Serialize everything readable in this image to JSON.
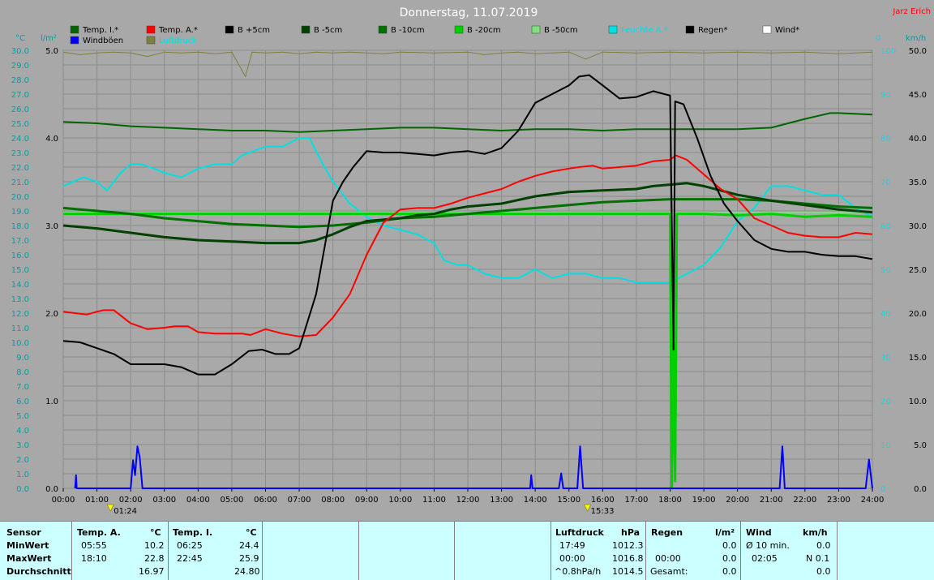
{
  "header": {
    "title": "Donnerstag, 11.07.2019",
    "station": "Jarz Erich"
  },
  "units": {
    "temp": "°C",
    "rain": "l/m²",
    "wind_left": "0",
    "wind": "km/h"
  },
  "legend": [
    {
      "label": "Temp. I.*",
      "color": "#006400"
    },
    {
      "label": "Temp. A.*",
      "color": "#ff0000"
    },
    {
      "label": "B +5cm",
      "color": "#000000"
    },
    {
      "label": "B -5cm",
      "color": "#004000"
    },
    {
      "label": "B -10cm",
      "color": "#007000"
    },
    {
      "label": "B -20cm",
      "color": "#00d000"
    },
    {
      "label": "B -50cm",
      "color": "#80e080"
    },
    {
      "label": "Feuchte A.*",
      "color": "#00e0e0"
    },
    {
      "label": "Regen*",
      "color": "#000000"
    },
    {
      "label": "Wind*",
      "color": "#ffffff"
    },
    {
      "label": "Windböen",
      "color": "#0000ff"
    },
    {
      "label": "Luftdruck",
      "color": "#7f7f3f"
    }
  ],
  "chart_data": {
    "type": "line",
    "title": "Donnerstag, 11.07.2019",
    "x_ticks": [
      "00:00",
      "01:00",
      "02:00",
      "03:00",
      "04:00",
      "05:00",
      "06:00",
      "07:00",
      "08:00",
      "09:00",
      "10:00",
      "11:00",
      "12:00",
      "13:00",
      "14:00",
      "15:00",
      "16:00",
      "17:00",
      "18:00",
      "19:00",
      "20:00",
      "21:00",
      "22:00",
      "23:00",
      "24:00"
    ],
    "xlim": [
      0,
      24
    ],
    "left_axis": {
      "unit": "°C",
      "ylim": [
        0,
        30
      ],
      "ticks": [
        "0.0",
        "1.0",
        "2.0",
        "3.0",
        "4.0",
        "5.0",
        "6.0",
        "7.0",
        "8.0",
        "9.0",
        "10.0",
        "11.0",
        "12.0",
        "13.0",
        "14.0",
        "15.0",
        "16.0",
        "17.0",
        "18.0",
        "19.0",
        "20.0",
        "21.0",
        "22.0",
        "23.0",
        "24.0",
        "25.0",
        "26.0",
        "27.0",
        "28.0",
        "29.0",
        "30.0"
      ]
    },
    "rain_axis": {
      "unit": "l/m²",
      "ylim": [
        0,
        5
      ],
      "ticks": [
        "0.0",
        "1.0",
        "2.0",
        "3.0",
        "4.0",
        "5.0"
      ]
    },
    "humidity_axis": {
      "ylim": [
        0,
        100
      ],
      "ticks": [
        "0",
        "10",
        "20",
        "30",
        "40",
        "50",
        "60",
        "70",
        "80",
        "90",
        "100"
      ]
    },
    "wind_axis": {
      "unit": "km/h",
      "ylim": [
        0,
        50
      ],
      "ticks": [
        "0.0",
        "5.0",
        "10.0",
        "15.0",
        "20.0",
        "25.0",
        "30.0",
        "35.0",
        "40.0",
        "45.0",
        "50.0"
      ]
    },
    "event_markers": [
      {
        "x": 1.4,
        "label": "01:24"
      },
      {
        "x": 15.55,
        "label": "15:33"
      }
    ],
    "series": [
      {
        "name": "Temp. I.*",
        "axis": "temp",
        "color": "#006400",
        "x": [
          0,
          1,
          2,
          3,
          4,
          5,
          6,
          7,
          8,
          9,
          10,
          11,
          12,
          13,
          14,
          15,
          16,
          17,
          18,
          19,
          20,
          21,
          22,
          22.75,
          23,
          24
        ],
        "y": [
          25.1,
          25.0,
          24.8,
          24.7,
          24.6,
          24.5,
          24.5,
          24.4,
          24.5,
          24.6,
          24.7,
          24.7,
          24.6,
          24.5,
          24.6,
          24.6,
          24.5,
          24.6,
          24.6,
          24.6,
          24.6,
          24.7,
          25.3,
          25.7,
          25.7,
          25.6
        ]
      },
      {
        "name": "Temp. A.*",
        "axis": "temp",
        "color": "#ff0000",
        "x": [
          0,
          0.7,
          1,
          1.2,
          1.5,
          2,
          2.5,
          3,
          3.3,
          3.7,
          4,
          4.5,
          5,
          5.3,
          5.55,
          6,
          6.5,
          7,
          7.5,
          8,
          8.5,
          9,
          9.5,
          10,
          10.5,
          11,
          11.5,
          12,
          12.5,
          13,
          13.5,
          14,
          14.5,
          15,
          15.3,
          15.7,
          16,
          16.5,
          17,
          17.5,
          18,
          18.17,
          18.5,
          19,
          19.5,
          20,
          20.5,
          21,
          21.5,
          22,
          22.5,
          23,
          23.5,
          24
        ],
        "y": [
          12.1,
          11.9,
          12.1,
          12.2,
          12.2,
          11.3,
          10.9,
          11.0,
          11.1,
          11.1,
          10.7,
          10.6,
          10.6,
          10.6,
          10.5,
          10.9,
          10.6,
          10.4,
          10.5,
          11.7,
          13.3,
          16.0,
          18.2,
          19.1,
          19.2,
          19.2,
          19.5,
          19.9,
          20.2,
          20.5,
          21.0,
          21.4,
          21.7,
          21.9,
          22.0,
          22.1,
          21.9,
          22.0,
          22.1,
          22.4,
          22.5,
          22.8,
          22.5,
          21.5,
          20.5,
          19.8,
          18.5,
          18.0,
          17.5,
          17.3,
          17.2,
          17.2,
          17.5,
          17.4
        ]
      },
      {
        "name": "B +5cm",
        "axis": "temp",
        "color": "#000000",
        "x": [
          0,
          0.5,
          1,
          1.5,
          2,
          2.5,
          3,
          3.5,
          4,
          4.5,
          5,
          5.5,
          5.9,
          6.3,
          6.7,
          7,
          7.5,
          8,
          8.3,
          8.6,
          9,
          9.5,
          10,
          10.5,
          11,
          11.5,
          12,
          12.5,
          13,
          13.5,
          14,
          14.5,
          15,
          15.3,
          15.6,
          16,
          16.5,
          17,
          17.5,
          18,
          18.1,
          18.15,
          18.4,
          18.8,
          19.2,
          19.6,
          20,
          20.5,
          21,
          21.5,
          22,
          22.5,
          23,
          23.5,
          24
        ],
        "y": [
          10.1,
          10.0,
          9.6,
          9.2,
          8.5,
          8.5,
          8.5,
          8.3,
          7.8,
          7.8,
          8.5,
          9.4,
          9.5,
          9.2,
          9.2,
          9.6,
          13.3,
          19.7,
          21.0,
          22.0,
          23.1,
          23.0,
          23.0,
          22.9,
          22.8,
          23.0,
          23.1,
          22.9,
          23.3,
          24.5,
          26.4,
          27.0,
          27.6,
          28.2,
          28.3,
          27.6,
          26.7,
          26.8,
          27.2,
          26.9,
          9.5,
          26.5,
          26.3,
          24.0,
          21.4,
          19.5,
          18.3,
          17.0,
          16.4,
          16.2,
          16.2,
          16.0,
          15.9,
          15.9,
          15.7
        ]
      },
      {
        "name": "B -5cm",
        "axis": "temp",
        "color": "#004000",
        "x": [
          0,
          1,
          2,
          3,
          4,
          5,
          6,
          6.5,
          7,
          7.5,
          8,
          8.5,
          9,
          9.5,
          10,
          10.5,
          11,
          11.5,
          12,
          13,
          14,
          15,
          16,
          17,
          17.5,
          18,
          18.5,
          19,
          19.5,
          20,
          21,
          22,
          23,
          24
        ],
        "y": [
          18.0,
          17.8,
          17.5,
          17.2,
          17.0,
          16.9,
          16.8,
          16.8,
          16.8,
          17.0,
          17.4,
          17.9,
          18.3,
          18.4,
          18.5,
          18.7,
          18.8,
          19.1,
          19.3,
          19.5,
          20.0,
          20.3,
          20.4,
          20.5,
          20.7,
          20.8,
          20.9,
          20.7,
          20.4,
          20.1,
          19.7,
          19.4,
          19.1,
          18.9
        ]
      },
      {
        "name": "B -10cm",
        "axis": "temp",
        "color": "#007000",
        "x": [
          0,
          1,
          2,
          3,
          4,
          5,
          6,
          7,
          8,
          9,
          10,
          11,
          12,
          13,
          14,
          15,
          16,
          17,
          18,
          19,
          20,
          21,
          22,
          23,
          24
        ],
        "y": [
          19.2,
          19.0,
          18.8,
          18.5,
          18.3,
          18.1,
          18.0,
          17.9,
          18.0,
          18.2,
          18.5,
          18.6,
          18.8,
          19.0,
          19.2,
          19.4,
          19.6,
          19.7,
          19.8,
          19.8,
          19.8,
          19.7,
          19.5,
          19.3,
          19.2
        ]
      },
      {
        "name": "B -20cm",
        "axis": "temp",
        "color": "#00d000",
        "x": [
          0,
          3,
          6,
          9,
          12,
          15,
          17,
          18,
          18.05,
          18.1,
          18.15,
          18.2,
          19,
          20,
          21,
          22,
          23,
          24
        ],
        "y": [
          18.8,
          18.8,
          18.8,
          18.8,
          18.8,
          18.8,
          18.8,
          18.8,
          0.0,
          10.0,
          0.5,
          18.8,
          18.8,
          18.7,
          18.8,
          18.6,
          18.7,
          18.6
        ]
      },
      {
        "name": "B -50cm",
        "axis": "temp",
        "color": "#80e080",
        "x": [
          0,
          24
        ],
        "y": [
          18.9,
          18.9
        ]
      },
      {
        "name": "Feuchte A.*",
        "axis": "humidity",
        "color": "#00e0e0",
        "x": [
          0,
          0.6,
          1,
          1.3,
          1.7,
          2,
          2.3,
          2.7,
          3,
          3.5,
          4,
          4.5,
          5,
          5.3,
          6,
          6.5,
          7,
          7.3,
          7.7,
          8,
          8.5,
          9,
          9.5,
          10,
          10.5,
          11,
          11.3,
          11.7,
          12,
          12.5,
          13,
          13.5,
          14,
          14.5,
          15,
          15.5,
          16,
          16.5,
          17,
          17.5,
          18,
          18.5,
          19,
          19.5,
          20,
          20.5,
          21,
          21.5,
          22,
          22.5,
          23,
          23.5,
          24
        ],
        "y": [
          69,
          71,
          70,
          68,
          72,
          74,
          74,
          73,
          72,
          71,
          73,
          74,
          74,
          76,
          78,
          78,
          80,
          80,
          74,
          70,
          65,
          62,
          60,
          59,
          58,
          56,
          52,
          51,
          51,
          49,
          48,
          48,
          50,
          48,
          49,
          49,
          48,
          48,
          47,
          47,
          47,
          49,
          51,
          55,
          61,
          64,
          69,
          69,
          68,
          67,
          67,
          64,
          62
        ]
      },
      {
        "name": "Luftdruck",
        "axis": "top",
        "color": "#7f7f3f",
        "x": [
          0,
          0.5,
          1,
          1.5,
          2,
          2.5,
          3,
          3.5,
          4,
          4.5,
          5,
          5.4,
          5.6,
          6,
          6.5,
          7,
          7.5,
          8,
          8.5,
          9,
          9.5,
          10,
          11,
          12,
          12.5,
          13,
          13.5,
          14,
          14.5,
          15,
          15.5,
          16,
          17,
          18,
          19,
          20,
          21,
          22,
          23,
          24
        ],
        "y": [
          4.98,
          4.95,
          4.97,
          4.98,
          4.97,
          4.93,
          4.98,
          4.97,
          4.98,
          4.96,
          4.98,
          4.7,
          4.98,
          4.97,
          4.98,
          4.96,
          4.98,
          4.97,
          4.98,
          4.97,
          4.96,
          4.98,
          4.97,
          4.98,
          4.95,
          4.97,
          4.98,
          4.96,
          4.97,
          4.98,
          4.9,
          4.98,
          4.97,
          4.98,
          4.97,
          4.98,
          4.97,
          4.98,
          4.96,
          4.98
        ]
      },
      {
        "name": "Windböen",
        "axis": "wind",
        "color": "#0000ff",
        "x": [
          0.35,
          0.38,
          0.4,
          2.0,
          2.07,
          2.13,
          2.2,
          2.27,
          2.35,
          2.45,
          13.85,
          13.88,
          13.92,
          14.7,
          14.77,
          14.83,
          15.25,
          15.33,
          15.42,
          21.25,
          21.33,
          21.4,
          23.8,
          23.9,
          24.0
        ],
        "y": [
          0,
          1.5,
          0,
          0,
          3.2,
          1.5,
          4.8,
          3.5,
          0,
          0,
          0,
          1.5,
          0,
          0,
          1.7,
          0,
          0,
          4.8,
          0,
          0,
          4.8,
          0,
          0,
          3.3,
          0
        ]
      }
    ]
  },
  "stats": {
    "sensor_header": "Sensor",
    "rows": [
      "MinWert",
      "MaxWert",
      "Durchschnitt"
    ],
    "temp_a": {
      "header": "Temp. A.",
      "unit": "°C",
      "min_time": "05:55",
      "min": "10.2",
      "max_time": "18:10",
      "max": "22.8",
      "avg": "16.97"
    },
    "temp_i": {
      "header": "Temp. I.",
      "unit": "°C",
      "min_time": "06:25",
      "min": "24.4",
      "max_time": "22:45",
      "max": "25.9",
      "avg": "24.80"
    },
    "pressure": {
      "header": "Luftdruck",
      "unit": "hPa",
      "min_time": "17:49",
      "min": "1012.3",
      "max_time": "00:00",
      "max": "1016.8",
      "trend": "^0.8hPa/h",
      "avg": "1014.5"
    },
    "rain": {
      "header": "Regen",
      "unit": "l/m²",
      "max_time": "00:00",
      "max": "0.0",
      "total_label": "Gesamt:",
      "total": "0.0",
      "min": "0.0"
    },
    "wind": {
      "header": "Wind",
      "unit": "km/h",
      "avg_label": "Ø 10 min.",
      "avg": "0.0",
      "max_time": "02:05",
      "max": "N 0.1",
      "mean": "0.0"
    }
  }
}
